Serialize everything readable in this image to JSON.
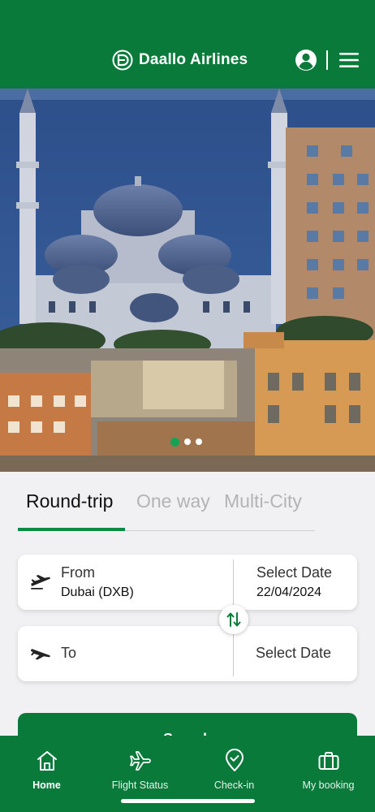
{
  "header": {
    "brand_name": "Daallo Airlines",
    "brand_logo_letter": "D",
    "profile_icon": "account-circle-icon",
    "menu_icon": "hamburger-menu-icon"
  },
  "hero": {
    "image_subject": "photo-mosque-city-sea",
    "carousel": {
      "total": 3,
      "active_index": 0
    }
  },
  "trip_tabs": [
    {
      "label": "Round-trip",
      "active": true
    },
    {
      "label": "One way",
      "active": false
    },
    {
      "label": "Multi-City",
      "active": false
    }
  ],
  "from_card": {
    "label": "From",
    "value": "Dubai (DXB)",
    "date_label": "Select Date",
    "date_value": "22/04/2024",
    "icon": "plane-takeoff-icon"
  },
  "to_card": {
    "label": "To",
    "date_label": "Select Date",
    "icon": "plane-landing-icon"
  },
  "swap_icon": "swap-vertical-icon",
  "search_button": {
    "label": "Search"
  },
  "bottom_nav": [
    {
      "label": "Home",
      "icon": "home-icon",
      "active": true
    },
    {
      "label": "Flight Status",
      "icon": "airplane-icon",
      "active": false
    },
    {
      "label": "Check-in",
      "icon": "location-check-icon",
      "active": false
    },
    {
      "label": "My booking",
      "icon": "briefcase-icon",
      "active": false
    }
  ],
  "colors": {
    "brand_green": "#0a7a3a",
    "accent_green": "#12a454",
    "inactive_tab": "#b3b3b8",
    "background": "#f1f1f3"
  }
}
